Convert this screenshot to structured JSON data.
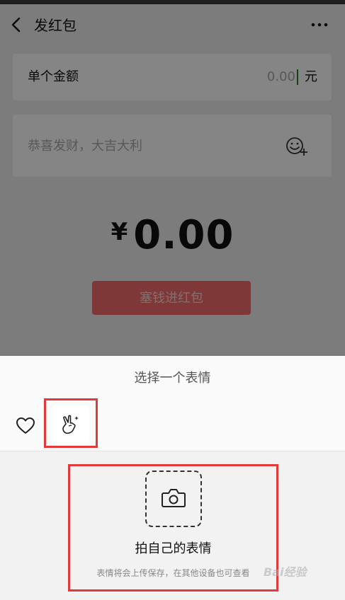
{
  "navbar": {
    "title": "发红包",
    "back_icon": "chevron-left-icon",
    "more_icon": "more-dots-icon"
  },
  "amount": {
    "label": "单个金额",
    "value": "0.00",
    "unit": "元"
  },
  "greeting": {
    "placeholder": "恭喜发财，大吉大利",
    "emoji_icon": "emoji-add-icon"
  },
  "total": {
    "currency": "¥",
    "value": "0.00"
  },
  "send_button": {
    "label": "塞钱进红包"
  },
  "sticker_sheet": {
    "title": "选择一个表情",
    "favorites_icon": "heart-icon",
    "selected_emoji_icon": "victory-hand-sparkle-icon",
    "capture_icon": "camera-icon",
    "capture_title": "拍自己的表情",
    "capture_note": "表情将会上传保存，在其他设备也可查看"
  },
  "watermark": {
    "text": "Bai经验"
  },
  "colors": {
    "highlight": "#e03a3a",
    "send_button": "#f26b6b",
    "overlay": "rgba(0,0,0,0.48)"
  }
}
